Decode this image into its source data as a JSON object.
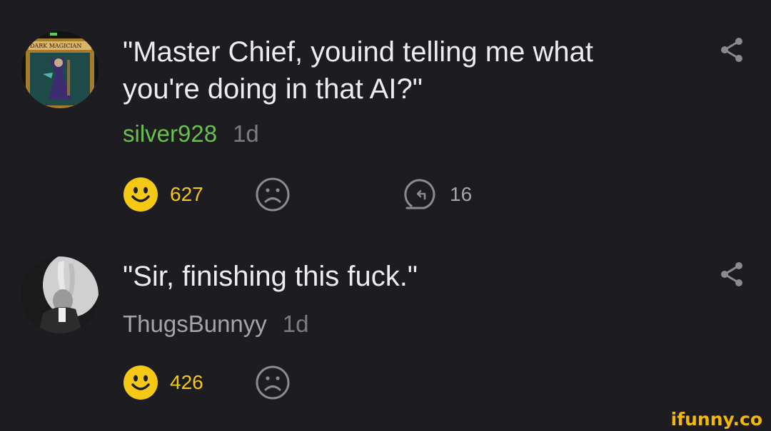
{
  "comments": [
    {
      "text": "\"Master Chief, youind telling me what you're doing in that AI?\"",
      "username": "silver928",
      "time": "1d",
      "smile_count": "627",
      "reply_count": "16",
      "username_color": "#6ac04d",
      "avatar_card_title": "DARK MAGICIAN"
    },
    {
      "text": "\"Sir, finishing this fuck.\"",
      "username": "ThugsBunnyy",
      "time": "1d",
      "smile_count": "426",
      "username_color": "#a4a4ab"
    }
  ],
  "watermark": "ifunny.co",
  "icons": {
    "smile": "smile-icon",
    "frown": "frown-icon",
    "reply": "reply-icon",
    "share": "share-icon"
  },
  "colors": {
    "background": "#1c1c21",
    "accent_yellow": "#f4c814"
  }
}
